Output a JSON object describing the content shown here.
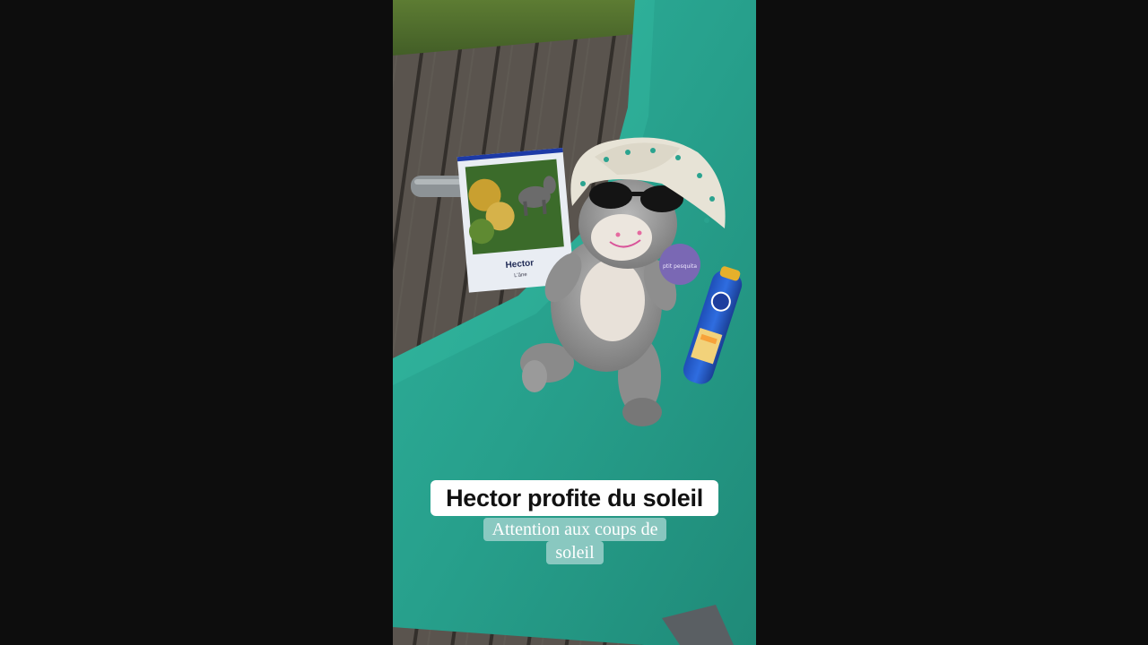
{
  "video": {
    "caption_title": "Hector profite du soleil",
    "caption_subtitle": "Attention aux coups de soleil"
  },
  "scene": {
    "card_title": "Hector",
    "card_subtitle": "L'âne",
    "badge_text": "ptit pesquita",
    "description": "Plush donkey with sun hat and sunglasses on a green deck chair, beside a card and a bottle of sunscreen"
  },
  "colors": {
    "background": "#0d0d0d",
    "chair": "#2aa38f",
    "deck": "#5b554f",
    "grass": "#4d6b2e"
  }
}
